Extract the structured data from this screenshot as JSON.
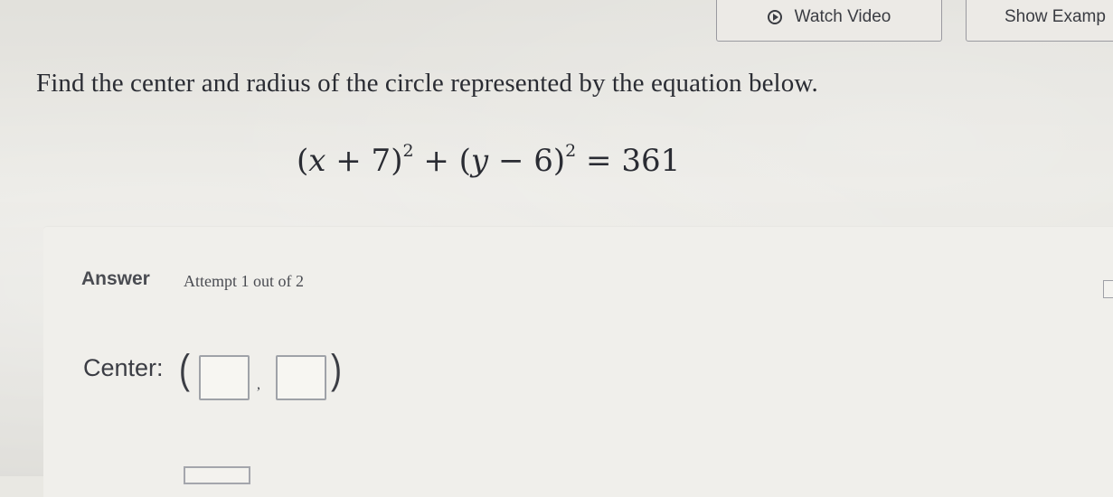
{
  "toolbar": {
    "watch_video_label": "Watch Video",
    "show_example_label": "Show Examp"
  },
  "question": {
    "prompt": "Find the center and radius of the circle represented by the equation below."
  },
  "equation": {
    "part1": "(",
    "x_var": "x",
    "part2": " + 7)",
    "exp1": "2",
    "part3": " + (",
    "y_var": "y",
    "part4": " − 6)",
    "exp2": "2",
    "part5": " = 361"
  },
  "answer": {
    "label": "Answer",
    "attempt_text": "Attempt 1 out of 2",
    "center_label": "Center:",
    "open_paren": "(",
    "comma": ",",
    "close_paren": ")",
    "center_x_value": "",
    "center_y_value": ""
  }
}
